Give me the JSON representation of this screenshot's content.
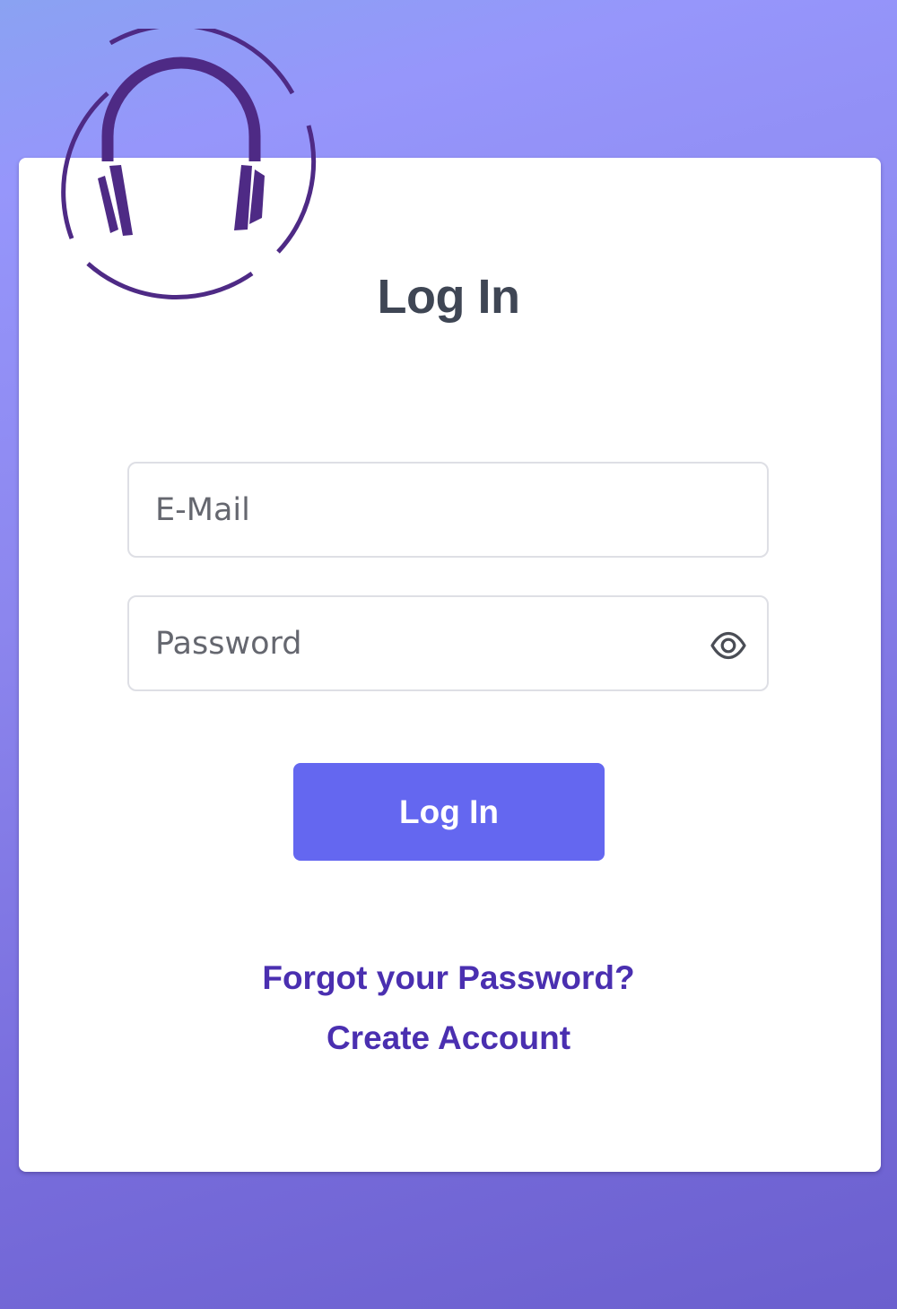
{
  "app": {
    "logo_icon": "headphones-icon",
    "logo_color": "#4e2a85"
  },
  "login": {
    "title": "Log In",
    "email_placeholder": "E-Mail",
    "email_value": "",
    "password_placeholder": "Password",
    "password_value": "",
    "toggle_visibility_icon": "eye-icon",
    "submit_label": "Log In",
    "forgot_password_link": "Forgot your Password?",
    "create_account_link": "Create Account"
  },
  "colors": {
    "primary_button": "#6467f0",
    "link": "#4a2fb0",
    "title": "#3f4654"
  }
}
